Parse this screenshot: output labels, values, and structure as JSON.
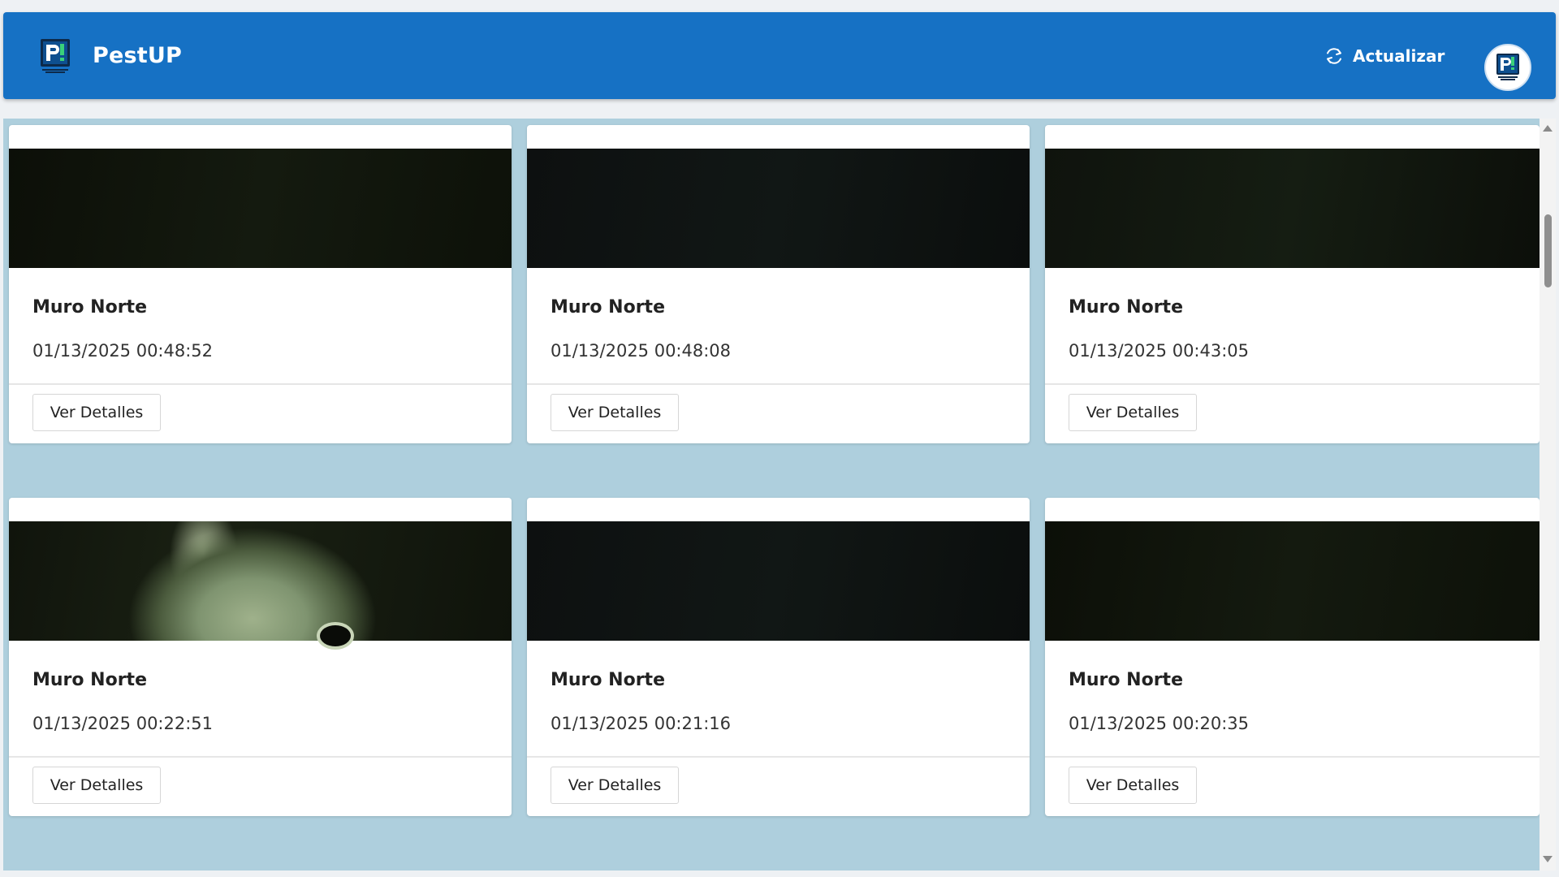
{
  "header": {
    "app_name": "PestUP",
    "refresh_label": "Actualizar",
    "brand_color": "#1671c4",
    "logo_icon": "pestup-logo-icon",
    "avatar_icon": "pestup-avatar-icon"
  },
  "content": {
    "background_color": "#aecfdd",
    "cards": [
      {
        "title": "Muro Norte",
        "timestamp": "01/13/2025 00:48:52",
        "button_label": "Ver Detalles"
      },
      {
        "title": "Muro Norte",
        "timestamp": "01/13/2025 00:48:08",
        "button_label": "Ver Detalles"
      },
      {
        "title": "Muro Norte",
        "timestamp": "01/13/2025 00:43:05",
        "button_label": "Ver Detalles"
      },
      {
        "title": "Muro Norte",
        "timestamp": "01/13/2025 00:22:51",
        "button_label": "Ver Detalles"
      },
      {
        "title": "Muro Norte",
        "timestamp": "01/13/2025 00:21:16",
        "button_label": "Ver Detalles"
      },
      {
        "title": "Muro Norte",
        "timestamp": "01/13/2025 00:20:35",
        "button_label": "Ver Detalles"
      }
    ]
  }
}
